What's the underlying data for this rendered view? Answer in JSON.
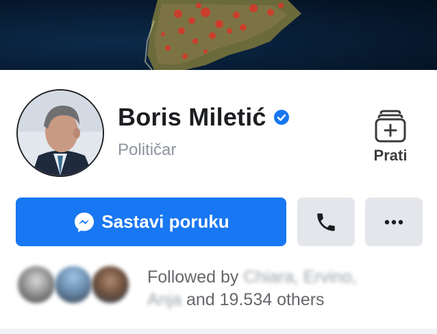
{
  "profile": {
    "name": "Boris Miletić",
    "category": "Političar"
  },
  "actions": {
    "follow_label": "Prati",
    "message_label": "Sastavi poruku"
  },
  "followers": {
    "prefix": "Followed by",
    "names_line1": "Chiara, Ervino,",
    "names_line2": "Anja",
    "suffix": "and 19.534 others"
  },
  "colors": {
    "accent": "#1877f2",
    "secondary_button": "#e4e6eb",
    "muted_text": "#8d949e"
  },
  "icons": [
    "verified-badge-icon",
    "follow-page-icon",
    "messenger-icon",
    "phone-icon",
    "more-icon"
  ]
}
